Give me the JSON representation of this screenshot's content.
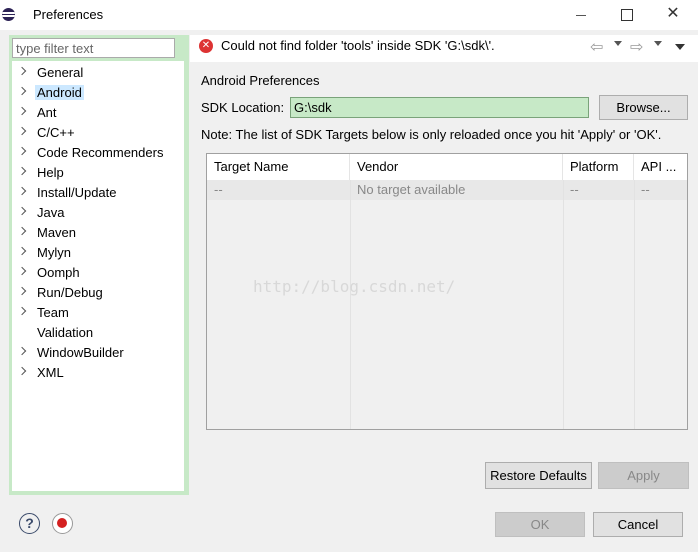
{
  "window": {
    "title": "Preferences",
    "app_icon": "eclipse-icon",
    "minimize_icon": "minimize-icon",
    "maximize_icon": "maximize-icon",
    "close_glyph": "✕"
  },
  "sidebar": {
    "filter_placeholder": "type filter text",
    "items": [
      {
        "label": "General",
        "expandable": true
      },
      {
        "label": "Android",
        "expandable": true,
        "selected": true
      },
      {
        "label": "Ant",
        "expandable": true
      },
      {
        "label": "C/C++",
        "expandable": true
      },
      {
        "label": "Code Recommenders",
        "expandable": true
      },
      {
        "label": "Help",
        "expandable": true
      },
      {
        "label": "Install/Update",
        "expandable": true
      },
      {
        "label": "Java",
        "expandable": true
      },
      {
        "label": "Maven",
        "expandable": true
      },
      {
        "label": "Mylyn",
        "expandable": true
      },
      {
        "label": "Oomph",
        "expandable": true
      },
      {
        "label": "Run/Debug",
        "expandable": true
      },
      {
        "label": "Team",
        "expandable": true
      },
      {
        "label": "Validation",
        "expandable": false
      },
      {
        "label": "WindowBuilder",
        "expandable": true
      },
      {
        "label": "XML",
        "expandable": true
      }
    ]
  },
  "header": {
    "error_icon": "error-icon",
    "error_glyph": "✕",
    "error_message": "Could not find folder 'tools' inside SDK 'G:\\sdk\\'.",
    "back_glyph": "⇦",
    "forward_glyph": "⇨"
  },
  "main": {
    "section_title": "Android Preferences",
    "sdk_label": "SDK Location:",
    "sdk_value": "G:\\sdk",
    "browse_label": "Browse...",
    "note": "Note: The list of SDK Targets below is only reloaded once you hit 'Apply' or 'OK'.",
    "table": {
      "columns": [
        "Target Name",
        "Vendor",
        "Platform",
        "API ..."
      ],
      "rows": [
        [
          "--",
          "No target available",
          "--",
          "--"
        ]
      ]
    },
    "watermark": "http://blog.csdn.net/",
    "restore_label": "Restore Defaults",
    "apply_label": "Apply"
  },
  "footer": {
    "help_glyph": "?",
    "ok_label": "OK",
    "cancel_label": "Cancel"
  },
  "colors": {
    "filter_highlight": "#c7e9c7",
    "selected_item": "#cce8ff",
    "error_red": "#dd3333"
  }
}
